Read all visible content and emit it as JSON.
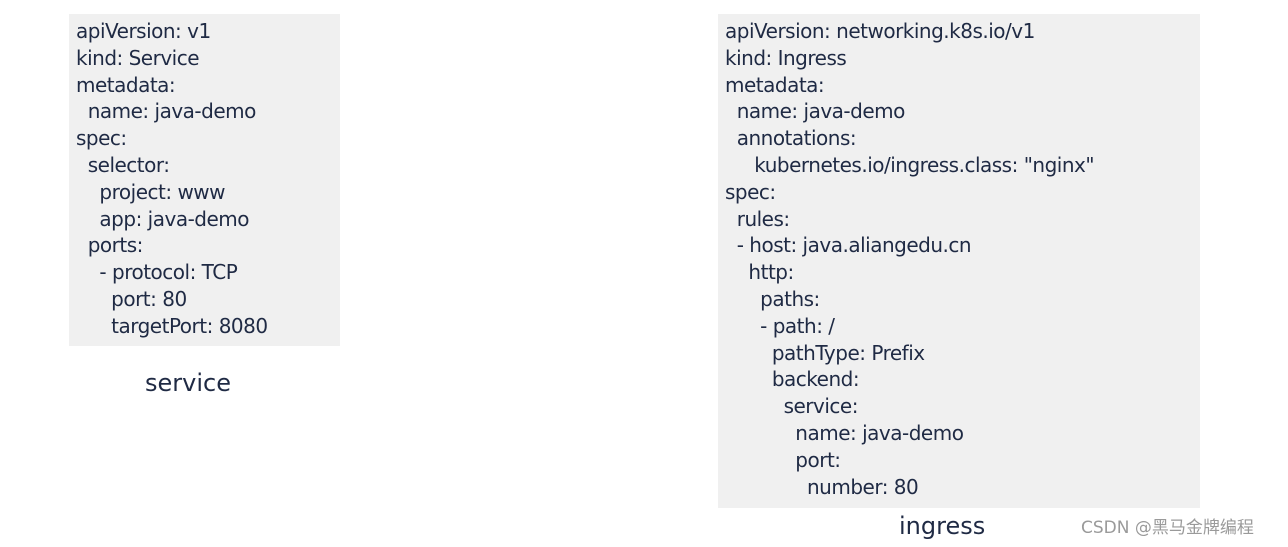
{
  "service": {
    "lines": [
      "apiVersion: v1",
      "kind: Service",
      "metadata:",
      "  name: java-demo",
      "spec:",
      "  selector:",
      "    project: www",
      "    app: java-demo",
      "  ports:",
      "    - protocol: TCP",
      "      port: 80",
      "      targetPort: 8080"
    ],
    "caption": "service"
  },
  "ingress": {
    "lines": [
      "apiVersion: networking.k8s.io/v1",
      "kind: Ingress",
      "metadata:",
      "  name: java-demo",
      "  annotations:",
      "     kubernetes.io/ingress.class: \"nginx\"",
      "spec:",
      "  rules:",
      "  - host: java.aliangedu.cn",
      "    http:",
      "      paths:",
      "      - path: /",
      "        pathType: Prefix",
      "        backend:",
      "          service:",
      "            name: java-demo",
      "            port:",
      "              number: 80"
    ],
    "caption": "ingress"
  },
  "watermark": "CSDN @黑马金牌编程"
}
